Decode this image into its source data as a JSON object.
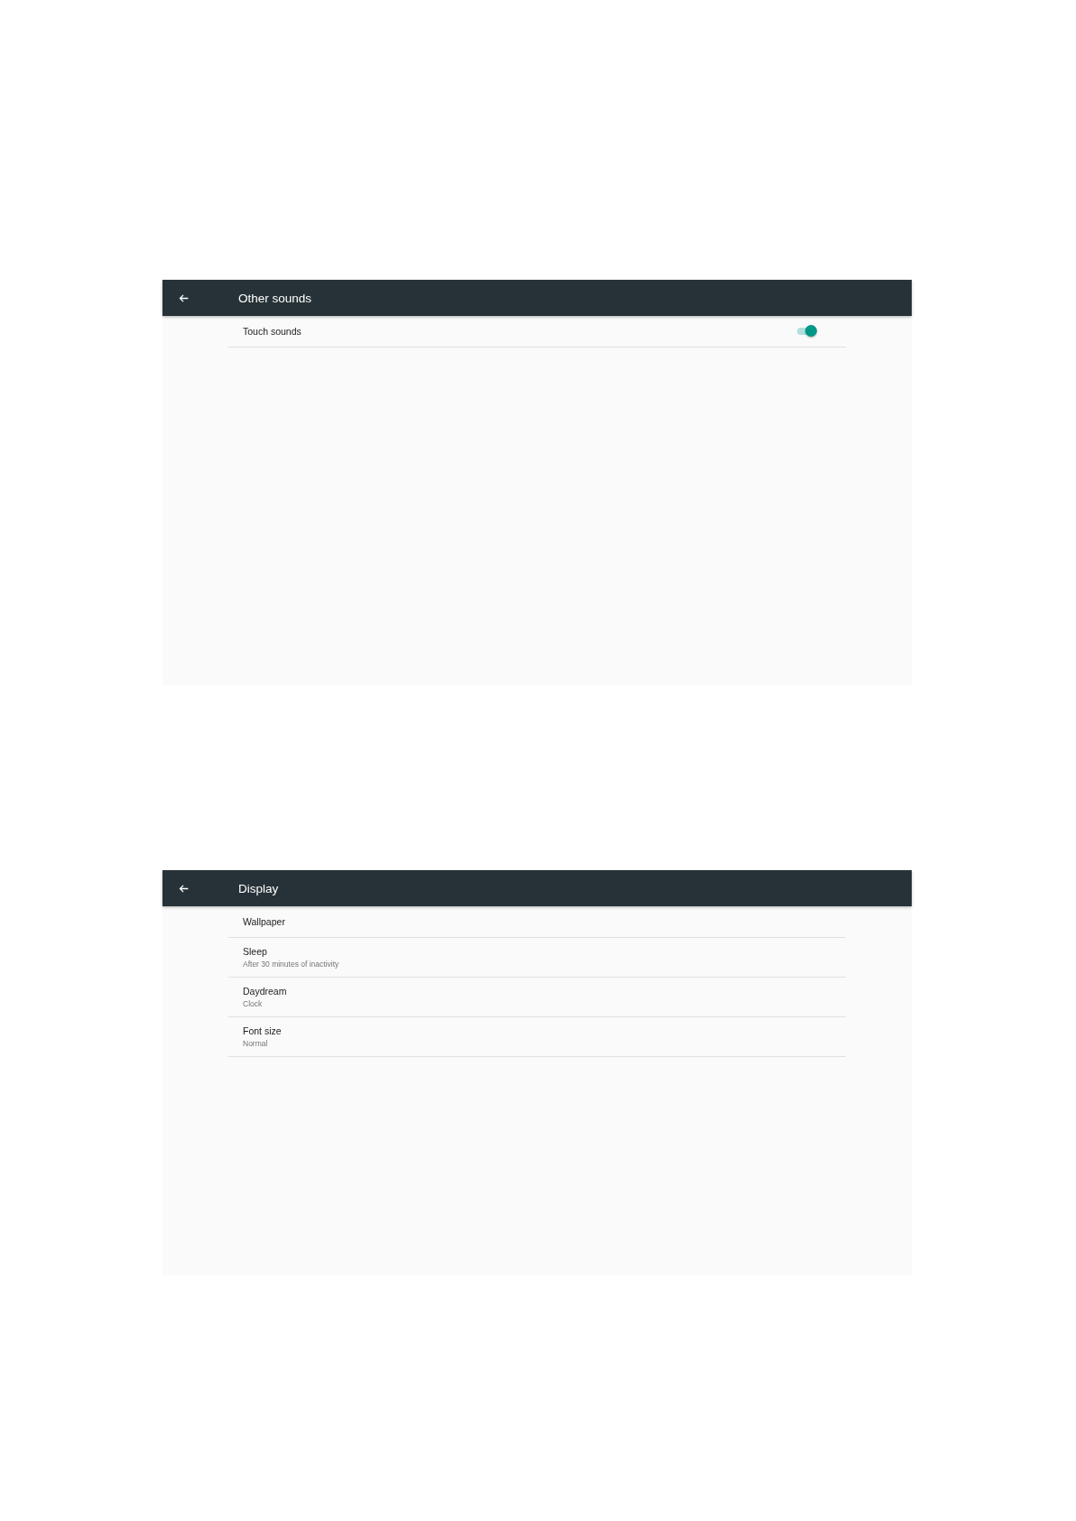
{
  "screens": [
    {
      "title": "Other sounds",
      "items": [
        {
          "kind": "toggle",
          "title": "Touch sounds",
          "on": true
        }
      ]
    },
    {
      "title": "Display",
      "items": [
        {
          "kind": "text",
          "title": "Wallpaper"
        },
        {
          "kind": "text",
          "title": "Sleep",
          "summary": "After 30 minutes of inactivity"
        },
        {
          "kind": "text",
          "title": "Daydream",
          "summary": "Clock"
        },
        {
          "kind": "text",
          "title": "Font size",
          "summary": "Normal"
        }
      ]
    }
  ]
}
